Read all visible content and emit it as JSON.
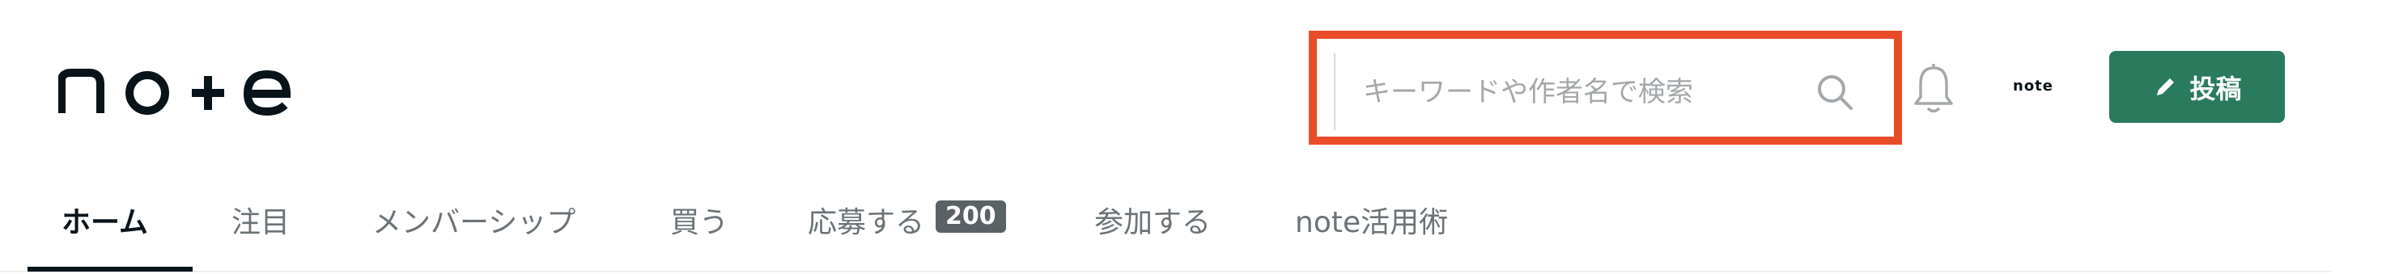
{
  "header": {
    "logo_text": "note"
  },
  "search": {
    "placeholder": "キーワードや作者名で検索",
    "value": ""
  },
  "avatar": {
    "label": "note"
  },
  "post_button": {
    "label": "投稿"
  },
  "tabs": [
    {
      "label": "ホーム",
      "active": true
    },
    {
      "label": "注目",
      "active": false
    },
    {
      "label": "メンバーシップ",
      "active": false
    },
    {
      "label": "買う",
      "active": false
    },
    {
      "label": "応募する",
      "active": false,
      "badge": "200"
    },
    {
      "label": "参加する",
      "active": false
    },
    {
      "label": "note活用術",
      "active": false
    }
  ],
  "colors": {
    "highlight": "#ea4c2a",
    "post_button": "#2a7a5e",
    "badge": "#5b6266"
  }
}
